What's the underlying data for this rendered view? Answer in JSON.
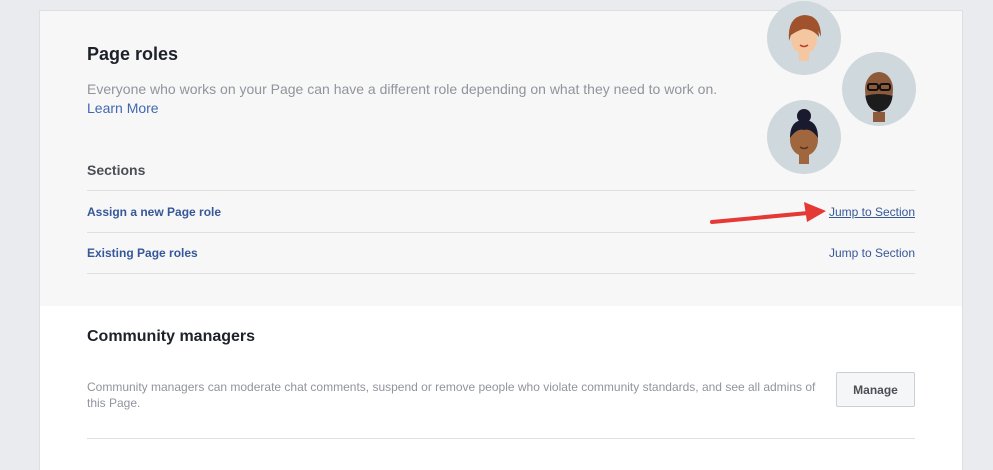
{
  "page_roles": {
    "title": "Page roles",
    "description": "Everyone who works on your Page can have a different role depending on what they need to work on.",
    "learn_more": "Learn More",
    "sections_label": "Sections",
    "sections": [
      {
        "label": "Assign a new Page role",
        "jump": "Jump to Section"
      },
      {
        "label": "Existing Page roles",
        "jump": "Jump to Section"
      }
    ]
  },
  "community_managers": {
    "title": "Community managers",
    "description": "Community managers can moderate chat comments, suspend or remove people who violate community standards, and see all admins of this Page.",
    "manage_button": "Manage"
  },
  "colors": {
    "link": "#365899",
    "annotation_arrow": "#e53935",
    "avatar_bg": "#cfd8dc"
  }
}
